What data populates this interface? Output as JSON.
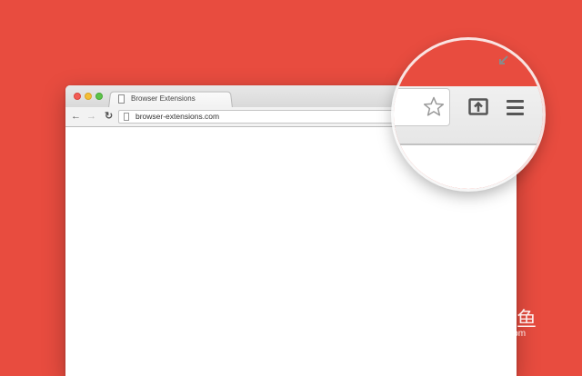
{
  "browser": {
    "tab_title": "Browser Extensions",
    "url": "browser-extensions.com",
    "nav": {
      "back": "←",
      "forward": "→",
      "reload": "↻"
    }
  },
  "icons": {
    "star": "star-icon",
    "share": "share-icon",
    "menu": "hamburger-menu-icon",
    "resize": "resize-icon"
  },
  "watermark": {
    "cn": "网多鱼",
    "en": "wduoyu.com"
  },
  "colors": {
    "background": "#e84c3f",
    "window": "#ffffff",
    "toolbar": "#f2f2f2"
  }
}
